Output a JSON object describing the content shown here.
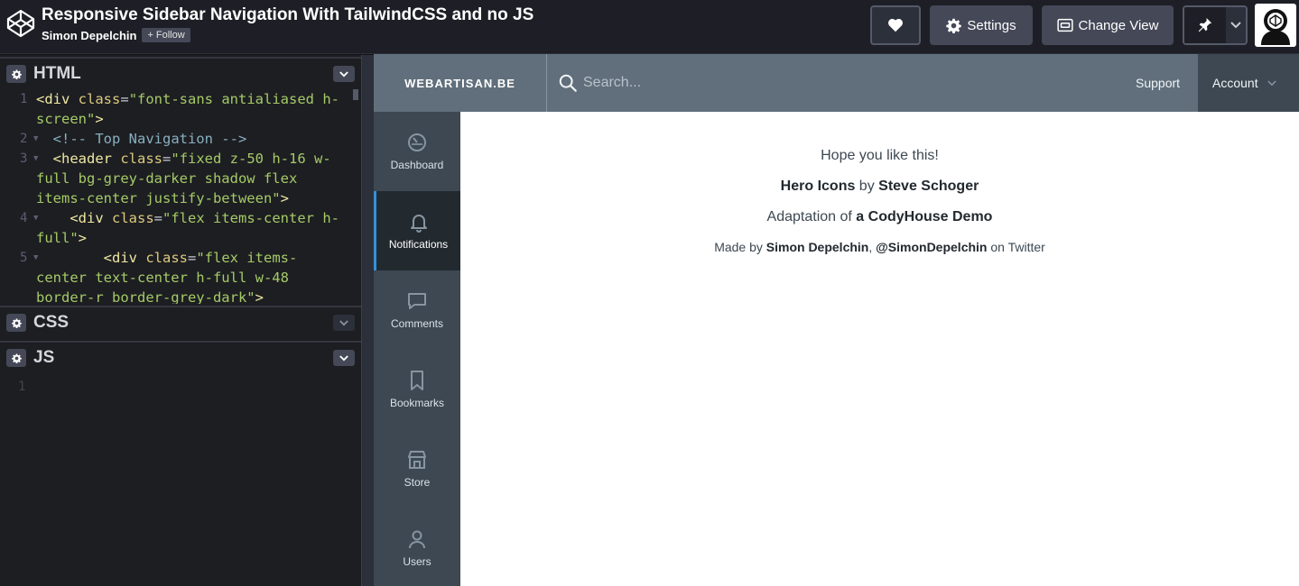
{
  "topbar": {
    "title": "Responsive Sidebar Navigation With TailwindCSS and no JS",
    "author": "Simon Depelchin",
    "follow_label": "Follow",
    "settings_label": "Settings",
    "change_view_label": "Change View"
  },
  "editors": {
    "html_title": "HTML",
    "css_title": "CSS",
    "js_title": "JS",
    "js_line_number": "1",
    "html_lines": [
      {
        "num": "1",
        "fold": false
      },
      {
        "num": "2",
        "fold": true
      },
      {
        "num": "3",
        "fold": true
      },
      {
        "num": "4",
        "fold": true
      },
      {
        "num": "5",
        "fold": true
      }
    ]
  },
  "preview": {
    "brand": "WEBARTISAN.BE",
    "search_placeholder": "Search...",
    "support": "Support",
    "account": "Account",
    "nav": [
      {
        "label": "Dashboard",
        "icon": "dashboard-icon",
        "active": false
      },
      {
        "label": "Notifications",
        "icon": "bell-icon",
        "active": true
      },
      {
        "label": "Comments",
        "icon": "comment-icon",
        "active": false
      },
      {
        "label": "Bookmarks",
        "icon": "bookmark-icon",
        "active": false
      },
      {
        "label": "Store",
        "icon": "store-icon",
        "active": false
      },
      {
        "label": "Users",
        "icon": "user-icon",
        "active": false
      }
    ],
    "content": {
      "line1": "Hope you like this!",
      "line2_a": "Hero Icons",
      "line2_b": " by ",
      "line2_c": "Steve Schoger",
      "line3_a": "Adaptation of ",
      "line3_b": "a CodyHouse Demo",
      "line4_a": "Made by ",
      "line4_b": "Simon Depelchin",
      "line4_c": ", ",
      "line4_d": "@SimonDepelchin",
      "line4_e": " on Twitter"
    }
  },
  "colors": {
    "accent": "#3490dc",
    "header_bg": "#606f7b",
    "sidebar_bg": "#3d4852"
  }
}
